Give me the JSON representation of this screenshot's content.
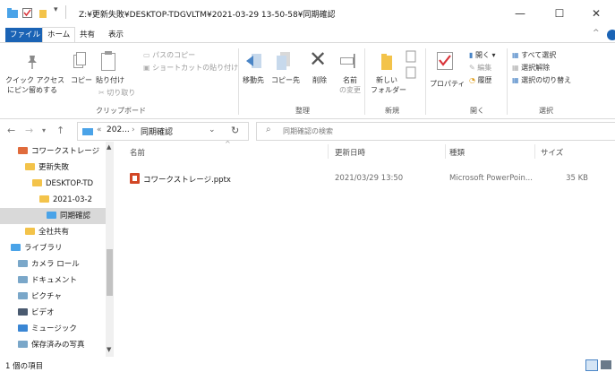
{
  "window": {
    "title": "Z:¥更新失敗¥DESKTOP-TDGVLTM¥2021-03-29 13-50-58¥同期確認",
    "minimize": "—",
    "maximize": "☐",
    "close": "✕"
  },
  "ribbon": {
    "tabs": [
      "ファイル",
      "ホーム",
      "共有",
      "表示"
    ],
    "clipboard": {
      "pin_label_1": "クイック アクセス",
      "pin_label_2": "にピン留めする",
      "copy": "コピー",
      "paste": "貼り付け",
      "copy_path": "パスのコピー",
      "paste_shortcut": "ショートカットの貼り付け",
      "cut": "切り取り",
      "group": "クリップボード"
    },
    "organize": {
      "move_to": "移動先",
      "copy_to": "コピー先",
      "delete": "削除",
      "rename_1": "名前",
      "rename_2": "の変更",
      "group": "整理"
    },
    "new": {
      "new_folder_1": "新しい",
      "new_folder_2": "フォルダー",
      "group": "新規"
    },
    "open": {
      "properties": "プロパティ",
      "open": "開く",
      "edit": "編集",
      "history": "履歴",
      "group": "開く"
    },
    "select": {
      "select_all": "すべて選択",
      "select_none": "選択解除",
      "invert": "選択の切り替え",
      "group": "選択"
    }
  },
  "address": {
    "chevron": "«",
    "parent": "202...",
    "separator": "›",
    "current": "同期確認",
    "search_placeholder": "同期確認の検索"
  },
  "nav_pane": {
    "items": [
      {
        "label": "コワークストレージ",
        "indent": 1
      },
      {
        "label": "更新失敗",
        "indent": 2
      },
      {
        "label": "DESKTOP-TD",
        "indent": 3
      },
      {
        "label": "2021-03-2",
        "indent": 4
      },
      {
        "label": "同期確認",
        "indent": 5
      },
      {
        "label": "全社共有",
        "indent": 2
      },
      {
        "label": "ライブラリ",
        "indent": 0
      },
      {
        "label": "カメラ ロール",
        "indent": 1
      },
      {
        "label": "ドキュメント",
        "indent": 1
      },
      {
        "label": "ピクチャ",
        "indent": 1
      },
      {
        "label": "ビデオ",
        "indent": 1
      },
      {
        "label": "ミュージック",
        "indent": 1
      },
      {
        "label": "保存済みの写真",
        "indent": 1
      }
    ]
  },
  "columns": {
    "name": "名前",
    "date": "更新日時",
    "type": "種類",
    "size": "サイズ"
  },
  "files": [
    {
      "name": "コワークストレージ.pptx",
      "date": "2021/03/29 13:50",
      "type": "Microsoft PowerPoin...",
      "size": "35 KB"
    }
  ],
  "status": {
    "count": "1 個の項目"
  },
  "colors": {
    "file_tab": "#1a63b5",
    "selected": "#d9d9d9",
    "folder": "#f3c34a"
  }
}
